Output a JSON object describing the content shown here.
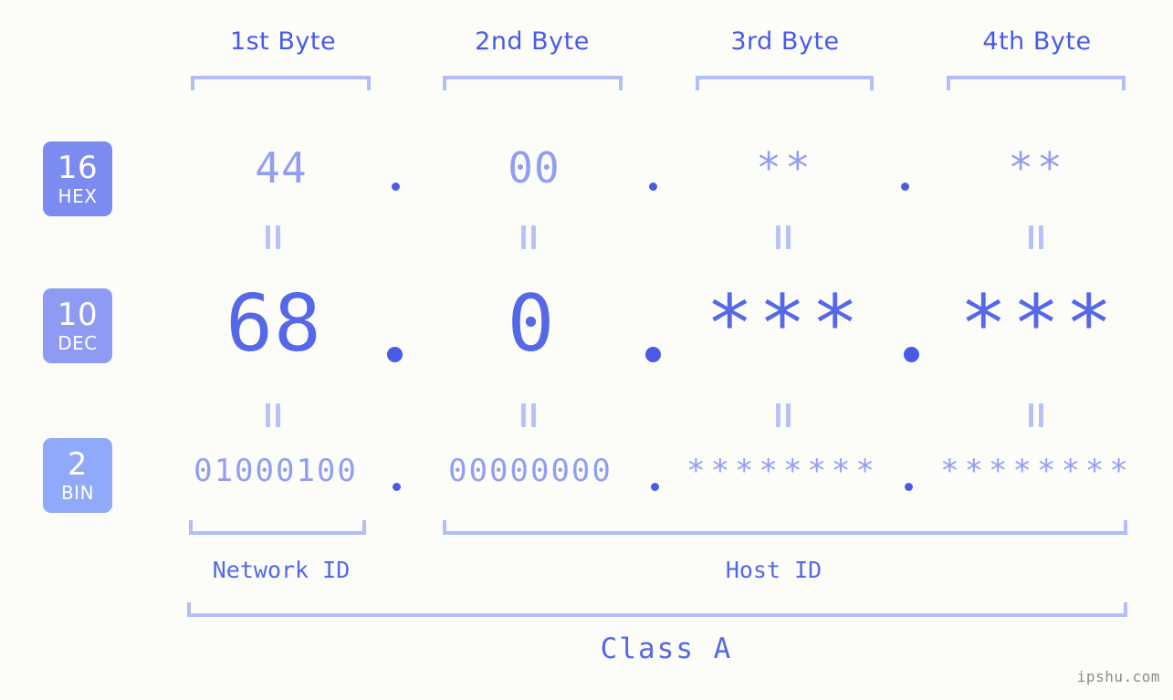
{
  "watermark": "ipshu.com",
  "header": {
    "byte_labels": [
      "1st Byte",
      "2nd Byte",
      "3rd Byte",
      "4th Byte"
    ]
  },
  "bases": [
    {
      "num": "16",
      "name": "HEX",
      "color": "#7b8bf0"
    },
    {
      "num": "10",
      "name": "DEC",
      "color": "#8f9bf3"
    },
    {
      "num": "2",
      "name": "BIN",
      "color": "#90a9f8"
    }
  ],
  "rows": {
    "hex": {
      "values": [
        "44",
        "00",
        "**",
        "**"
      ],
      "separator": "."
    },
    "dec": {
      "values": [
        "68",
        "0",
        "***",
        "***"
      ],
      "separator": "."
    },
    "bin": {
      "values": [
        "01000100",
        "00000000",
        "********",
        "********"
      ],
      "separator": "."
    }
  },
  "connectors": {
    "symbol": "="
  },
  "footer": {
    "network_id_label": "Network ID",
    "host_id_label": "Host ID",
    "class_label": "Class A"
  },
  "colors": {
    "background": "#fcfdf9",
    "accent_strong": "#4a5ae8",
    "accent_mid": "#5468e8",
    "accent_light": "#929ef3",
    "bracket": "#b3bdf7"
  }
}
